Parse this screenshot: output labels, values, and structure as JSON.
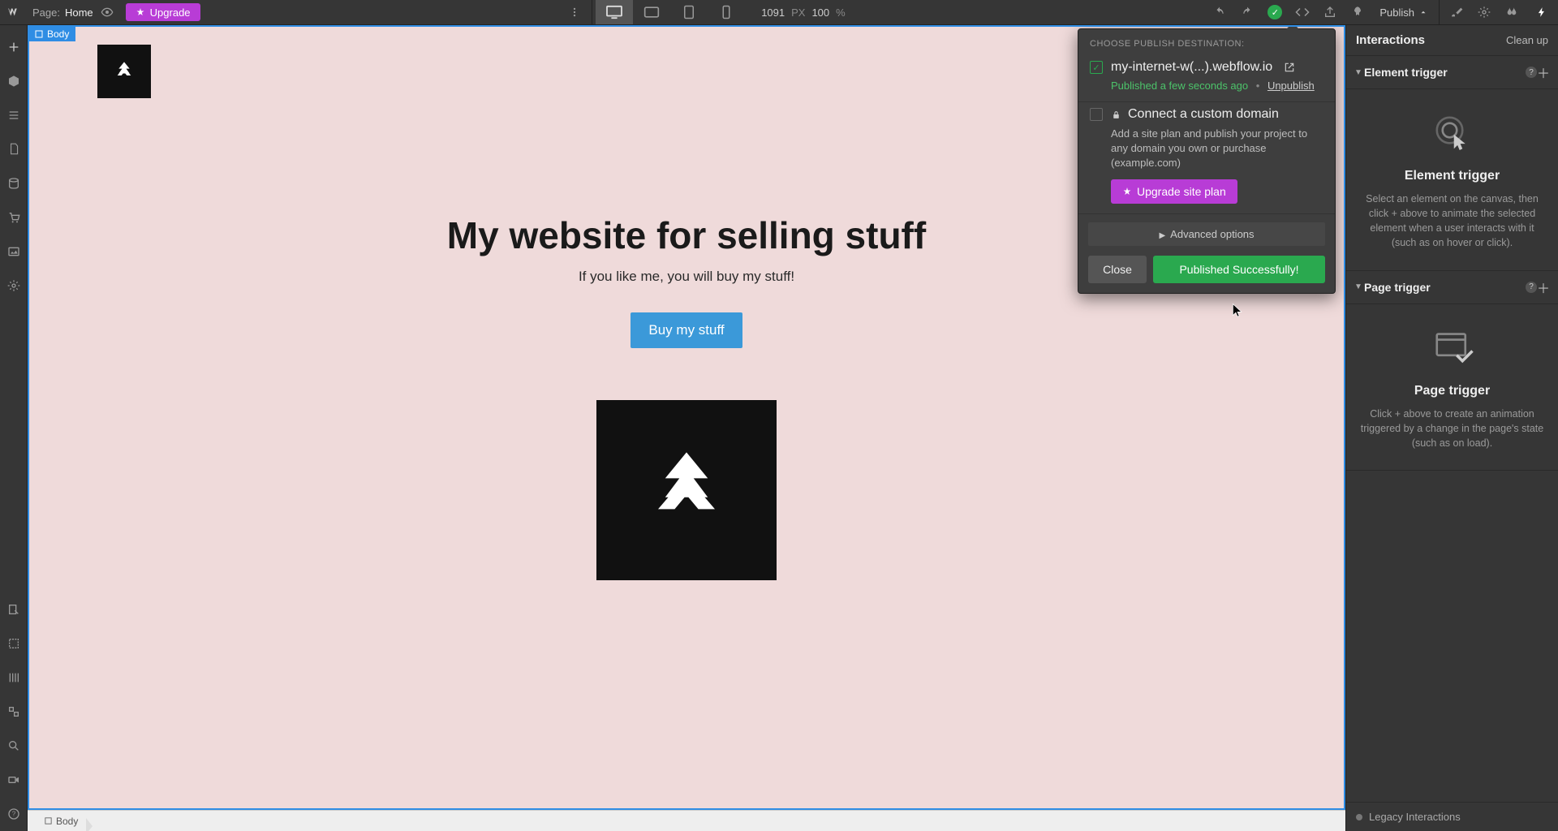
{
  "topbar": {
    "page_label": "Page:",
    "page_name": "Home",
    "upgrade": "Upgrade",
    "width": "1091",
    "width_unit": "PX",
    "zoom": "100",
    "zoom_unit": "%",
    "publish": "Publish"
  },
  "canvas": {
    "body_tag": "Body",
    "hero_title": "My website for selling stuff",
    "hero_sub": "If you like me, you will buy my stuff!",
    "cta": "Buy my stuff"
  },
  "breadcrumb": {
    "item": "Body"
  },
  "popover": {
    "header": "CHOOSE PUBLISH DESTINATION:",
    "domain": "my-internet-w(...).webflow.io",
    "status": "Published a few seconds ago",
    "unpublish": "Unpublish",
    "connect_title": "Connect a custom domain",
    "connect_desc": "Add a site plan and publish your project to any domain you own or purchase (example.com)",
    "upgrade_plan": "Upgrade site plan",
    "advanced": "Advanced options",
    "close": "Close",
    "published": "Published Successfully!"
  },
  "right": {
    "panel_title": "Interactions",
    "cleanup": "Clean up",
    "element_trigger_head": "Element trigger",
    "element_trigger_title": "Element trigger",
    "element_trigger_desc": "Select an element on the canvas, then click + above to animate the selected element when a user interacts with it (such as on hover or click).",
    "page_trigger_head": "Page trigger",
    "page_trigger_title": "Page trigger",
    "page_trigger_desc": "Click + above to create an animation triggered by a change in the page's state (such as on load).",
    "legacy": "Legacy Interactions"
  }
}
